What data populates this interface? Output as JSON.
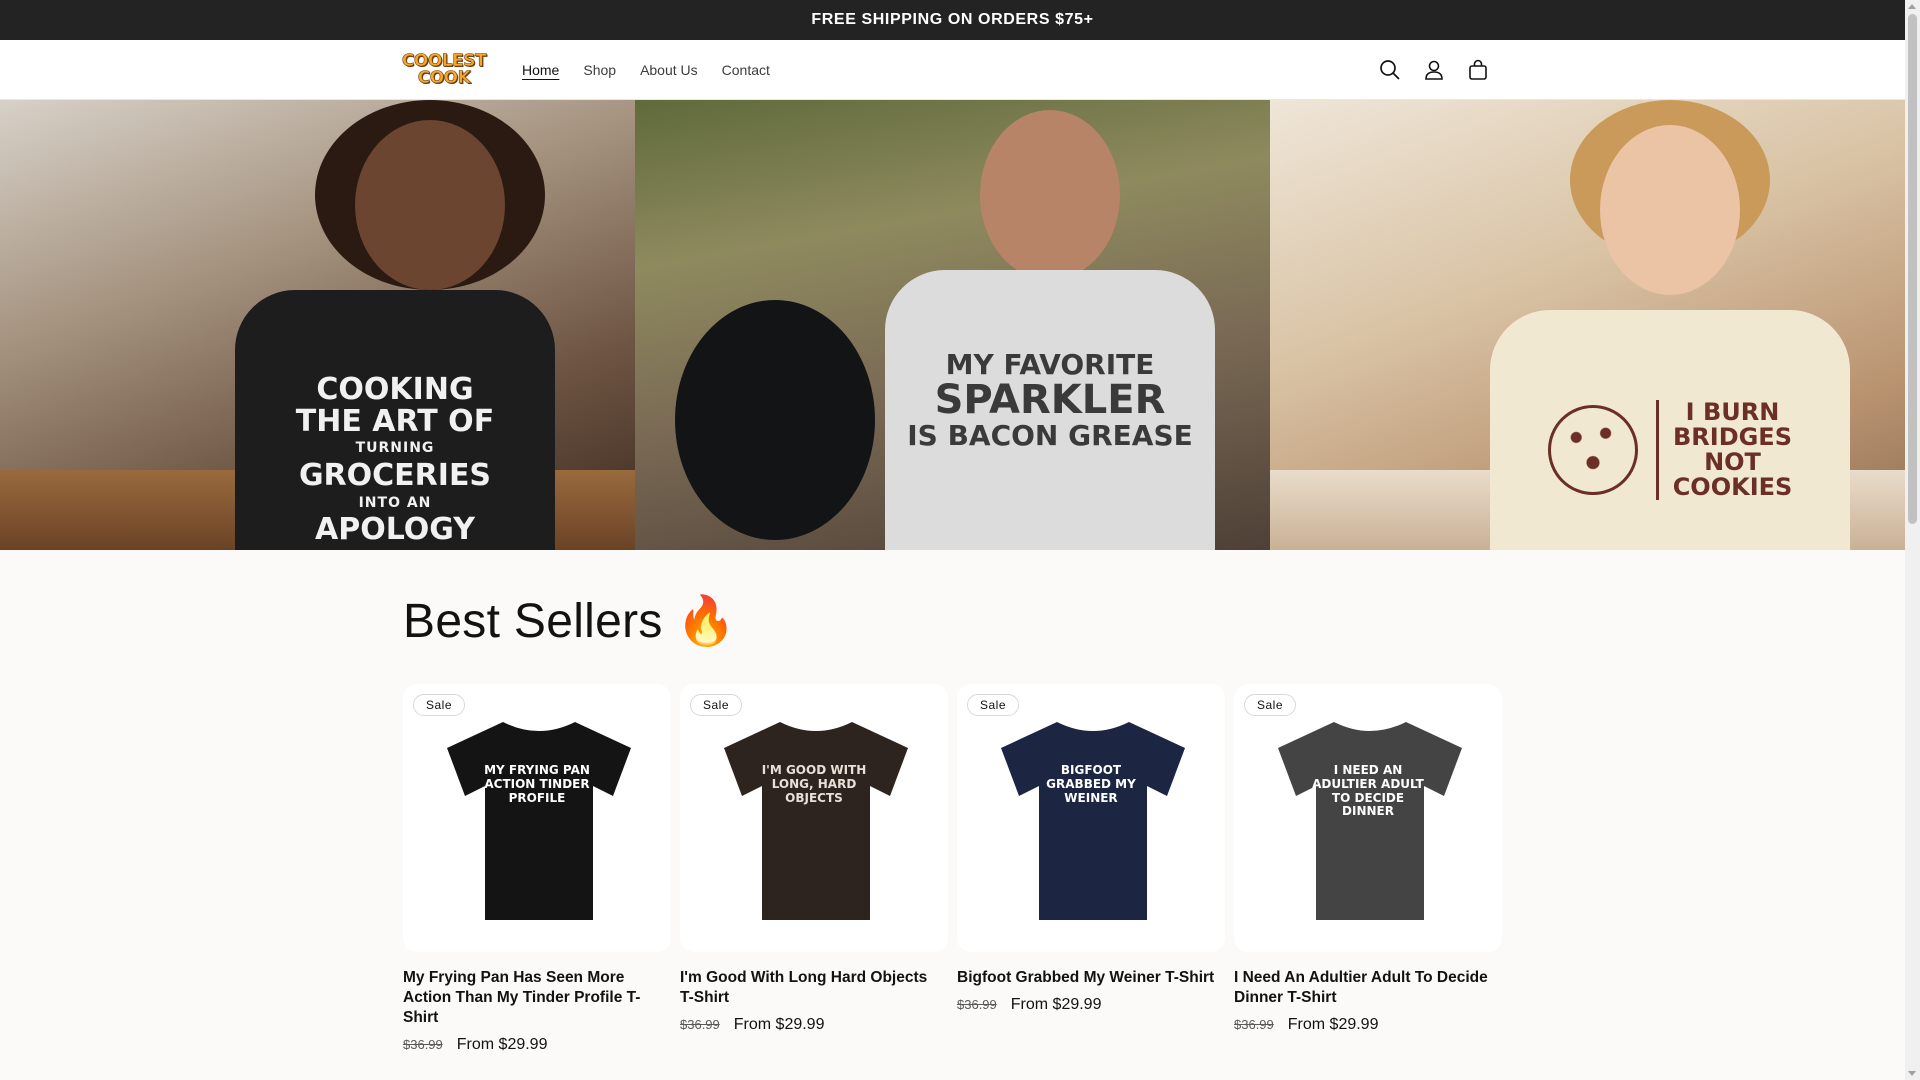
{
  "announcement": "FREE SHIPPING ON ORDERS $75+",
  "header": {
    "logo_line1": "COOLEST",
    "logo_line2": "COOK",
    "nav": [
      {
        "label": "Home",
        "active": true
      },
      {
        "label": "Shop",
        "active": false
      },
      {
        "label": "About Us",
        "active": false
      },
      {
        "label": "Contact",
        "active": false
      }
    ],
    "icons": [
      "search-icon",
      "account-icon",
      "cart-icon"
    ]
  },
  "hero": {
    "panel1": {
      "l1": "Cooking",
      "l2": "the art of",
      "l3": "turning",
      "l4": "groceries",
      "l5": "into an",
      "l6": "apology"
    },
    "panel2": {
      "l1": "My favorite",
      "l2": "Sparkler",
      "l3": "is bacon grease"
    },
    "panel3": {
      "l1": "I burn",
      "l2": "bridges",
      "l3": "not",
      "l4": "cookies"
    }
  },
  "best_sellers": {
    "title": "Best Sellers 🔥",
    "products": [
      {
        "badge": "Sale",
        "title": "My Frying Pan Has Seen More Action Than My Tinder Profile T-Shirt",
        "old_price": "$36.99",
        "price": "From $29.99",
        "shirt_color": "#141414",
        "shirt_text": "My Frying Pan Action Tinder Profile",
        "text_color": "#ffffff"
      },
      {
        "badge": "Sale",
        "title": "I'm Good With Long Hard Objects T-Shirt",
        "old_price": "$36.99",
        "price": "From $29.99",
        "shirt_color": "#2e241f",
        "shirt_text": "I'm good with long, hard objects",
        "text_color": "#e8e0d6"
      },
      {
        "badge": "Sale",
        "title": "Bigfoot Grabbed My Weiner T-Shirt",
        "old_price": "$36.99",
        "price": "From $29.99",
        "shirt_color": "#1c2642",
        "shirt_text": "Bigfoot grabbed my Weiner",
        "text_color": "#ffffff"
      },
      {
        "badge": "Sale",
        "title": "I Need An Adultier Adult To Decide Dinner T-Shirt",
        "old_price": "$36.99",
        "price": "From $29.99",
        "shirt_color": "#444444",
        "shirt_text": "I need an adultier adult to decide dinner",
        "text_color": "#ffffff"
      }
    ]
  }
}
